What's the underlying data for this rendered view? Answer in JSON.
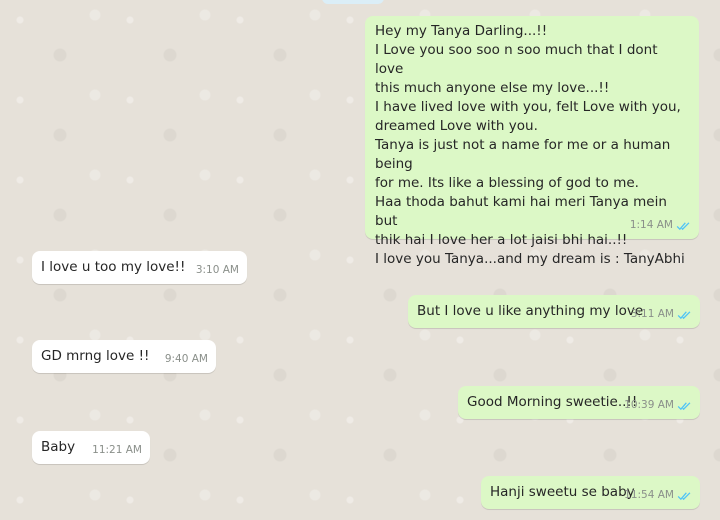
{
  "chat": {
    "messages": [
      {
        "direction": "outgoing",
        "text": "Hey my Tanya Darling...!!\nI Love you soo soo n soo much that I dont love\nthis much anyone else my love...!!\nI have lived love with you, felt Love with you,\ndreamed Love with you.\nTanya is just not a name for me or a human being\nfor me. Its like a blessing of god to me.\nHaa thoda bahut kami hai meri Tanya mein but\nthik hai I love her a lot jaisi bhi hai..!!\nI love you Tanya...and my dream is : TanyAbhi",
        "time": "1:14 AM",
        "status": "read"
      },
      {
        "direction": "incoming",
        "text": "I love u too my love!!",
        "time": "3:10 AM"
      },
      {
        "direction": "outgoing",
        "text": "But I love u like anything my love",
        "time": "3:11 AM",
        "status": "read"
      },
      {
        "direction": "incoming",
        "text": "GD mrng love !!",
        "time": "9:40 AM"
      },
      {
        "direction": "outgoing",
        "text": "Good Morning sweetie..!!",
        "time": "10:39 AM",
        "status": "read"
      },
      {
        "direction": "incoming",
        "text": "Baby",
        "time": "11:21 AM"
      },
      {
        "direction": "outgoing",
        "text": "Hanji sweetu se baby",
        "time": "11:54 AM",
        "status": "read"
      }
    ]
  },
  "colors": {
    "incoming_bubble": "#ffffff",
    "outgoing_bubble": "#dcf8c6",
    "read_ticks": "#4fc3f7",
    "background": "#e6e1d9"
  },
  "icons": {
    "read_receipt": "double-check-icon"
  }
}
